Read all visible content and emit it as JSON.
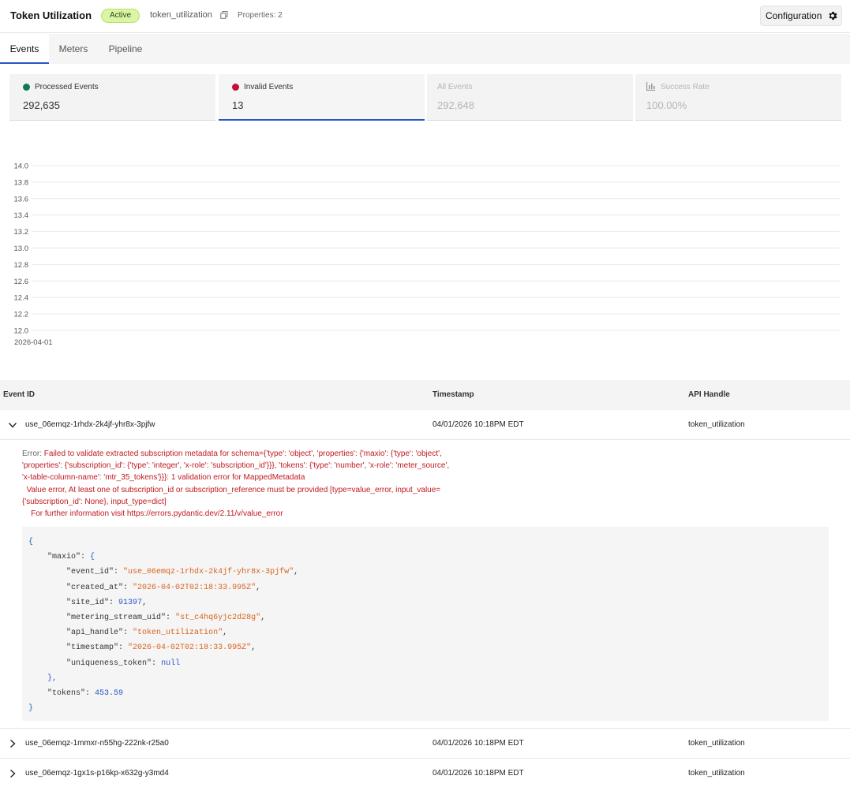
{
  "header": {
    "title": "Token Utilization",
    "status": "Active",
    "handle": "token_utilization",
    "properties": "Properties: 2",
    "config_label": "Configuration"
  },
  "tabs": [
    {
      "label": "Events",
      "active": true
    },
    {
      "label": "Meters",
      "active": false
    },
    {
      "label": "Pipeline",
      "active": false
    }
  ],
  "metrics": [
    {
      "label": "Processed Events",
      "value": "292,635",
      "color": "#0e7b55",
      "active": false
    },
    {
      "label": "Invalid Events",
      "value": "13",
      "color": "#c2103e",
      "active": true
    },
    {
      "label": "All Events",
      "value": "292,648",
      "dim": true
    },
    {
      "label": "Success Rate",
      "value": "100.00%",
      "dim": true,
      "icon": "bar-chart-icon"
    }
  ],
  "chart_data": {
    "type": "line",
    "x": [
      "2026-04-01"
    ],
    "series": [
      {
        "values": []
      }
    ],
    "ylim": [
      12.0,
      14.0
    ],
    "yticks": [
      "14.0",
      "13.8",
      "13.6",
      "13.4",
      "13.2",
      "13.0",
      "12.8",
      "12.6",
      "12.4",
      "12.2",
      "12.0"
    ],
    "xticks": [
      "2026-04-01"
    ],
    "grid": true
  },
  "table": {
    "columns": [
      "Event ID",
      "Timestamp",
      "API Handle"
    ],
    "rows": [
      {
        "id": "use_06emqz-1rhdx-2k4jf-yhr8x-3pjfw",
        "timestamp": "04/01/2026 10:18PM EDT",
        "handle": "token_utilization",
        "expanded": true
      },
      {
        "id": "use_06emqz-1mmxr-n55hg-222nk-r25a0",
        "timestamp": "04/01/2026 10:18PM EDT",
        "handle": "token_utilization",
        "expanded": false
      },
      {
        "id": "use_06emqz-1gx1s-p16kp-x632g-y3md4",
        "timestamp": "04/01/2026 10:18PM EDT",
        "handle": "token_utilization",
        "expanded": false
      }
    ]
  },
  "detail": {
    "error_prefix": "Error: ",
    "error_lines": [
      "Failed to validate extracted subscription metadata for schema={'type': 'object', 'properties': {'maxio': {'type': 'object',",
      "'properties': {'subscription_id': {'type': 'integer', 'x-role': 'subscription_id'}}}, 'tokens': {'type': 'number', 'x-role': 'meter_source',",
      "'x-table-column-name': 'mtr_35_tokens'}}}: 1 validation error for MappedMetadata",
      "  Value error, At least one of subscription_id or subscription_reference must be provided [type=value_error, input_value=",
      "{'subscription_id': None}, input_type=dict]",
      "    For further information visit https://errors.pydantic.dev/2.11/v/value_error"
    ],
    "json": {
      "event_id": "\"use_06emqz-1rhdx-2k4jf-yhr8x-3pjfw\"",
      "created_at": "\"2026-04-02T02:18:33.995Z\"",
      "site_id": "91397",
      "metering_stream_uid": "\"st_c4hq6yjc2d28g\"",
      "api_handle": "\"token_utilization\"",
      "timestamp": "\"2026-04-02T02:18:33.995Z\"",
      "uniqueness_token": "null",
      "tokens": "453.59"
    }
  }
}
